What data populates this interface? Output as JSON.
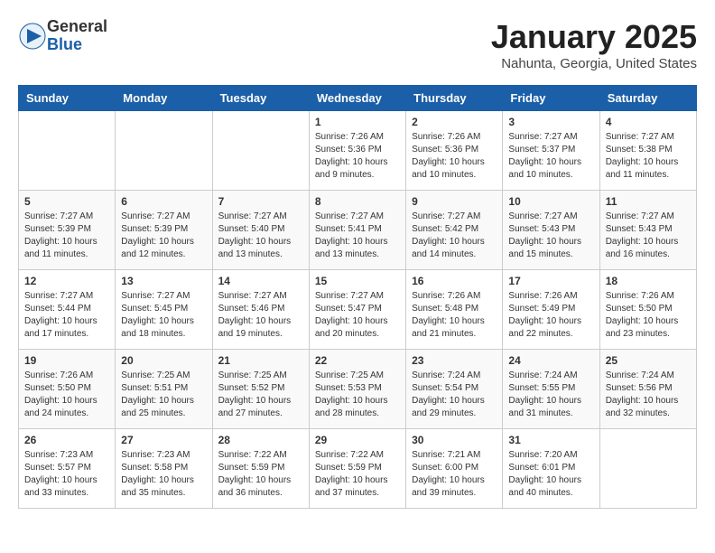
{
  "header": {
    "logo": {
      "general": "General",
      "blue": "Blue"
    },
    "month": "January 2025",
    "location": "Nahunta, Georgia, United States"
  },
  "weekdays": [
    "Sunday",
    "Monday",
    "Tuesday",
    "Wednesday",
    "Thursday",
    "Friday",
    "Saturday"
  ],
  "weeks": [
    [
      {
        "day": "",
        "info": ""
      },
      {
        "day": "",
        "info": ""
      },
      {
        "day": "",
        "info": ""
      },
      {
        "day": "1",
        "info": "Sunrise: 7:26 AM\nSunset: 5:36 PM\nDaylight: 10 hours\nand 9 minutes."
      },
      {
        "day": "2",
        "info": "Sunrise: 7:26 AM\nSunset: 5:36 PM\nDaylight: 10 hours\nand 10 minutes."
      },
      {
        "day": "3",
        "info": "Sunrise: 7:27 AM\nSunset: 5:37 PM\nDaylight: 10 hours\nand 10 minutes."
      },
      {
        "day": "4",
        "info": "Sunrise: 7:27 AM\nSunset: 5:38 PM\nDaylight: 10 hours\nand 11 minutes."
      }
    ],
    [
      {
        "day": "5",
        "info": "Sunrise: 7:27 AM\nSunset: 5:39 PM\nDaylight: 10 hours\nand 11 minutes."
      },
      {
        "day": "6",
        "info": "Sunrise: 7:27 AM\nSunset: 5:39 PM\nDaylight: 10 hours\nand 12 minutes."
      },
      {
        "day": "7",
        "info": "Sunrise: 7:27 AM\nSunset: 5:40 PM\nDaylight: 10 hours\nand 13 minutes."
      },
      {
        "day": "8",
        "info": "Sunrise: 7:27 AM\nSunset: 5:41 PM\nDaylight: 10 hours\nand 13 minutes."
      },
      {
        "day": "9",
        "info": "Sunrise: 7:27 AM\nSunset: 5:42 PM\nDaylight: 10 hours\nand 14 minutes."
      },
      {
        "day": "10",
        "info": "Sunrise: 7:27 AM\nSunset: 5:43 PM\nDaylight: 10 hours\nand 15 minutes."
      },
      {
        "day": "11",
        "info": "Sunrise: 7:27 AM\nSunset: 5:43 PM\nDaylight: 10 hours\nand 16 minutes."
      }
    ],
    [
      {
        "day": "12",
        "info": "Sunrise: 7:27 AM\nSunset: 5:44 PM\nDaylight: 10 hours\nand 17 minutes."
      },
      {
        "day": "13",
        "info": "Sunrise: 7:27 AM\nSunset: 5:45 PM\nDaylight: 10 hours\nand 18 minutes."
      },
      {
        "day": "14",
        "info": "Sunrise: 7:27 AM\nSunset: 5:46 PM\nDaylight: 10 hours\nand 19 minutes."
      },
      {
        "day": "15",
        "info": "Sunrise: 7:27 AM\nSunset: 5:47 PM\nDaylight: 10 hours\nand 20 minutes."
      },
      {
        "day": "16",
        "info": "Sunrise: 7:26 AM\nSunset: 5:48 PM\nDaylight: 10 hours\nand 21 minutes."
      },
      {
        "day": "17",
        "info": "Sunrise: 7:26 AM\nSunset: 5:49 PM\nDaylight: 10 hours\nand 22 minutes."
      },
      {
        "day": "18",
        "info": "Sunrise: 7:26 AM\nSunset: 5:50 PM\nDaylight: 10 hours\nand 23 minutes."
      }
    ],
    [
      {
        "day": "19",
        "info": "Sunrise: 7:26 AM\nSunset: 5:50 PM\nDaylight: 10 hours\nand 24 minutes."
      },
      {
        "day": "20",
        "info": "Sunrise: 7:25 AM\nSunset: 5:51 PM\nDaylight: 10 hours\nand 25 minutes."
      },
      {
        "day": "21",
        "info": "Sunrise: 7:25 AM\nSunset: 5:52 PM\nDaylight: 10 hours\nand 27 minutes."
      },
      {
        "day": "22",
        "info": "Sunrise: 7:25 AM\nSunset: 5:53 PM\nDaylight: 10 hours\nand 28 minutes."
      },
      {
        "day": "23",
        "info": "Sunrise: 7:24 AM\nSunset: 5:54 PM\nDaylight: 10 hours\nand 29 minutes."
      },
      {
        "day": "24",
        "info": "Sunrise: 7:24 AM\nSunset: 5:55 PM\nDaylight: 10 hours\nand 31 minutes."
      },
      {
        "day": "25",
        "info": "Sunrise: 7:24 AM\nSunset: 5:56 PM\nDaylight: 10 hours\nand 32 minutes."
      }
    ],
    [
      {
        "day": "26",
        "info": "Sunrise: 7:23 AM\nSunset: 5:57 PM\nDaylight: 10 hours\nand 33 minutes."
      },
      {
        "day": "27",
        "info": "Sunrise: 7:23 AM\nSunset: 5:58 PM\nDaylight: 10 hours\nand 35 minutes."
      },
      {
        "day": "28",
        "info": "Sunrise: 7:22 AM\nSunset: 5:59 PM\nDaylight: 10 hours\nand 36 minutes."
      },
      {
        "day": "29",
        "info": "Sunrise: 7:22 AM\nSunset: 5:59 PM\nDaylight: 10 hours\nand 37 minutes."
      },
      {
        "day": "30",
        "info": "Sunrise: 7:21 AM\nSunset: 6:00 PM\nDaylight: 10 hours\nand 39 minutes."
      },
      {
        "day": "31",
        "info": "Sunrise: 7:20 AM\nSunset: 6:01 PM\nDaylight: 10 hours\nand 40 minutes."
      },
      {
        "day": "",
        "info": ""
      }
    ]
  ]
}
